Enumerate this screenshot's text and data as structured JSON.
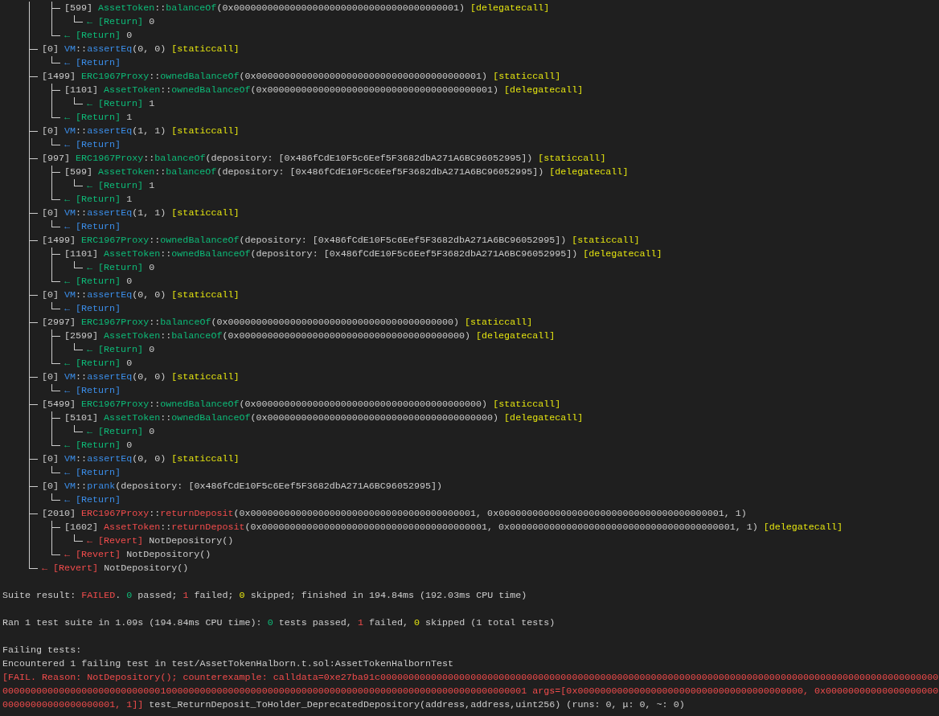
{
  "trace": [
    {
      "kind": "call",
      "children": [
        {
          "kind": "call",
          "gas": "[599]",
          "contract": "AssetToken",
          "sep": "::",
          "function": "balanceOf",
          "args": "(0x0000000000000000000000000000000000000001)",
          "call_type": "[delegatecall]",
          "result": {
            "label": "← [Return]",
            "value": "0"
          }
        }
      ],
      "result": {
        "label": "← [Return]",
        "value": "0"
      }
    },
    {
      "kind": "cheatcode",
      "gas": "[0]",
      "contract": "VM",
      "sep": "::",
      "function": "assertEq",
      "args": "(0, 0)",
      "call_type": "[staticcall]",
      "result": {
        "label": "← [Return]"
      }
    },
    {
      "kind": "call",
      "gas": "[1499]",
      "contract": "ERC1967Proxy",
      "sep": "::",
      "function": "ownedBalanceOf",
      "args": "(0x0000000000000000000000000000000000000001)",
      "call_type": "[staticcall]",
      "children": [
        {
          "kind": "call",
          "gas": "[1101]",
          "contract": "AssetToken",
          "sep": "::",
          "function": "ownedBalanceOf",
          "args": "(0x0000000000000000000000000000000000000001)",
          "call_type": "[delegatecall]",
          "result": {
            "label": "← [Return]",
            "value": "1"
          }
        }
      ],
      "result": {
        "label": "← [Return]",
        "value": "1"
      }
    },
    {
      "kind": "cheatcode",
      "gas": "[0]",
      "contract": "VM",
      "sep": "::",
      "function": "assertEq",
      "args": "(1, 1)",
      "call_type": "[staticcall]",
      "result": {
        "label": "← [Return]"
      }
    },
    {
      "kind": "call",
      "gas": "[997]",
      "contract": "ERC1967Proxy",
      "sep": "::",
      "function": "balanceOf",
      "args": "(depository: [0x486fCdE10F5c6Eef5F3682dbA271A6BC96052995])",
      "call_type": "[staticcall]",
      "children": [
        {
          "kind": "call",
          "gas": "[599]",
          "contract": "AssetToken",
          "sep": "::",
          "function": "balanceOf",
          "args": "(depository: [0x486fCdE10F5c6Eef5F3682dbA271A6BC96052995])",
          "call_type": "[delegatecall]",
          "result": {
            "label": "← [Return]",
            "value": "1"
          }
        }
      ],
      "result": {
        "label": "← [Return]",
        "value": "1"
      }
    },
    {
      "kind": "cheatcode",
      "gas": "[0]",
      "contract": "VM",
      "sep": "::",
      "function": "assertEq",
      "args": "(1, 1)",
      "call_type": "[staticcall]",
      "result": {
        "label": "← [Return]"
      }
    },
    {
      "kind": "call",
      "gas": "[1499]",
      "contract": "ERC1967Proxy",
      "sep": "::",
      "function": "ownedBalanceOf",
      "args": "(depository: [0x486fCdE10F5c6Eef5F3682dbA271A6BC96052995])",
      "call_type": "[staticcall]",
      "children": [
        {
          "kind": "call",
          "gas": "[1101]",
          "contract": "AssetToken",
          "sep": "::",
          "function": "ownedBalanceOf",
          "args": "(depository: [0x486fCdE10F5c6Eef5F3682dbA271A6BC96052995])",
          "call_type": "[delegatecall]",
          "result": {
            "label": "← [Return]",
            "value": "0"
          }
        }
      ],
      "result": {
        "label": "← [Return]",
        "value": "0"
      }
    },
    {
      "kind": "cheatcode",
      "gas": "[0]",
      "contract": "VM",
      "sep": "::",
      "function": "assertEq",
      "args": "(0, 0)",
      "call_type": "[staticcall]",
      "result": {
        "label": "← [Return]"
      }
    },
    {
      "kind": "call",
      "gas": "[2997]",
      "contract": "ERC1967Proxy",
      "sep": "::",
      "function": "balanceOf",
      "args": "(0x0000000000000000000000000000000000000000)",
      "call_type": "[staticcall]",
      "children": [
        {
          "kind": "call",
          "gas": "[2599]",
          "contract": "AssetToken",
          "sep": "::",
          "function": "balanceOf",
          "args": "(0x0000000000000000000000000000000000000000)",
          "call_type": "[delegatecall]",
          "result": {
            "label": "← [Return]",
            "value": "0"
          }
        }
      ],
      "result": {
        "label": "← [Return]",
        "value": "0"
      }
    },
    {
      "kind": "cheatcode",
      "gas": "[0]",
      "contract": "VM",
      "sep": "::",
      "function": "assertEq",
      "args": "(0, 0)",
      "call_type": "[staticcall]",
      "result": {
        "label": "← [Return]"
      }
    },
    {
      "kind": "call",
      "gas": "[5499]",
      "contract": "ERC1967Proxy",
      "sep": "::",
      "function": "ownedBalanceOf",
      "args": "(0x0000000000000000000000000000000000000000)",
      "call_type": "[staticcall]",
      "children": [
        {
          "kind": "call",
          "gas": "[5101]",
          "contract": "AssetToken",
          "sep": "::",
          "function": "ownedBalanceOf",
          "args": "(0x0000000000000000000000000000000000000000)",
          "call_type": "[delegatecall]",
          "result": {
            "label": "← [Return]",
            "value": "0"
          }
        }
      ],
      "result": {
        "label": "← [Return]",
        "value": "0"
      }
    },
    {
      "kind": "cheatcode",
      "gas": "[0]",
      "contract": "VM",
      "sep": "::",
      "function": "assertEq",
      "args": "(0, 0)",
      "call_type": "[staticcall]",
      "result": {
        "label": "← [Return]"
      }
    },
    {
      "kind": "cheatcode",
      "gas": "[0]",
      "contract": "VM",
      "sep": "::",
      "function": "prank",
      "args": "(depository: [0x486fCdE10F5c6Eef5F3682dbA271A6BC96052995])",
      "result": {
        "label": "← [Return]"
      }
    },
    {
      "kind": "revert",
      "gas": "[2010]",
      "contract": "ERC1967Proxy",
      "sep": "::",
      "function": "returnDeposit",
      "args": "(0x0000000000000000000000000000000000000001, 0x0000000000000000000000000000000000000001, 1)",
      "children": [
        {
          "kind": "revert",
          "gas": "[1602]",
          "contract": "AssetToken",
          "sep": "::",
          "function": "returnDeposit",
          "args": "(0x0000000000000000000000000000000000000001, 0x0000000000000000000000000000000000000001, 1)",
          "call_type": "[delegatecall]",
          "result": {
            "label": "← [Revert]",
            "value": "NotDepository()"
          }
        }
      ],
      "result": {
        "label": "← [Revert]",
        "value": "NotDepository()"
      }
    }
  ],
  "trace_result": {
    "kind": "revert",
    "label": "← [Revert]",
    "value": "NotDepository()"
  },
  "suite_result": [
    {
      "kind": "plain",
      "text": "Suite result: "
    },
    {
      "kind": "fail",
      "text": "FAILED"
    },
    {
      "kind": "plain",
      "text": ". "
    },
    {
      "kind": "pass",
      "text": "0"
    },
    {
      "kind": "plain",
      "text": " passed; "
    },
    {
      "kind": "fail",
      "text": "1"
    },
    {
      "kind": "plain",
      "text": " failed; "
    },
    {
      "kind": "skip",
      "text": "0"
    },
    {
      "kind": "plain",
      "text": " skipped; finished in 194.84ms (192.03ms CPU time)"
    }
  ],
  "run_summary": [
    {
      "kind": "plain",
      "text": "Ran 1 test suite in 1.09s (194.84ms CPU time): "
    },
    {
      "kind": "pass",
      "text": "0"
    },
    {
      "kind": "plain",
      "text": " tests passed, "
    },
    {
      "kind": "fail",
      "text": "1"
    },
    {
      "kind": "plain",
      "text": " failed, "
    },
    {
      "kind": "skip",
      "text": "0"
    },
    {
      "kind": "plain",
      "text": " skipped (1 total tests)"
    }
  ],
  "failing_heading": "Failing tests:",
  "failing_count": "Encountered 1 failing test in test/AssetTokenHalborn.t.sol:AssetTokenHalbornTest",
  "failure": [
    {
      "kind": "fail",
      "text": "[FAIL. Reason: NotDepository(); counterexample: calldata=0xe27ba91c000000000000000000000000000000000000000000000000000000000000000000000000000000000000000000000000000000000000000000000000000000010000000000000000000000000000000000000000000000000000000000000001 args=[0x0000000000000000000000000000000000000000, 0x0000000000000000000000000000000000000001, 1]]"
    },
    {
      "kind": "plain",
      "text": " test_ReturnDeposit_ToHolder_DeprecatedDepository(address,address,uint256) (runs: 0, μ: 0, ~: 0)"
    }
  ]
}
